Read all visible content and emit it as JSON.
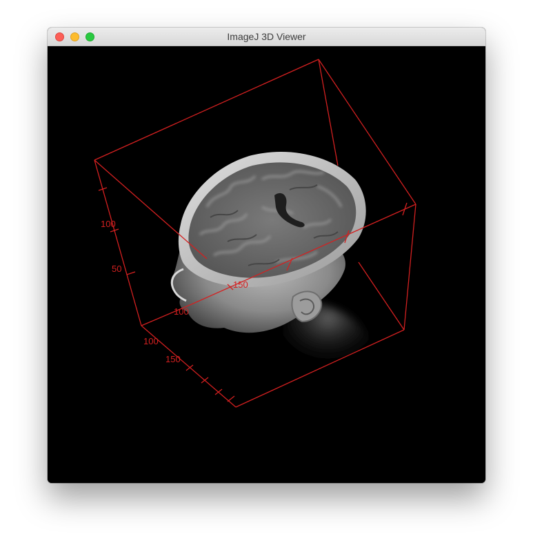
{
  "window": {
    "title": "ImageJ 3D Viewer"
  },
  "viewer": {
    "background_color": "#000000",
    "bounding_box_color": "#d42020",
    "volume_render_subject": "head MRI with cut-away skull showing brain",
    "axis_labels": {
      "v_100": "100",
      "v_50": "50",
      "d_100": "100",
      "d_150": "150",
      "h_100": "100",
      "h_150": "150"
    }
  },
  "icons": {
    "close": "close-traffic-light-icon",
    "minimize": "minimize-traffic-light-icon",
    "zoom": "zoom-traffic-light-icon"
  }
}
